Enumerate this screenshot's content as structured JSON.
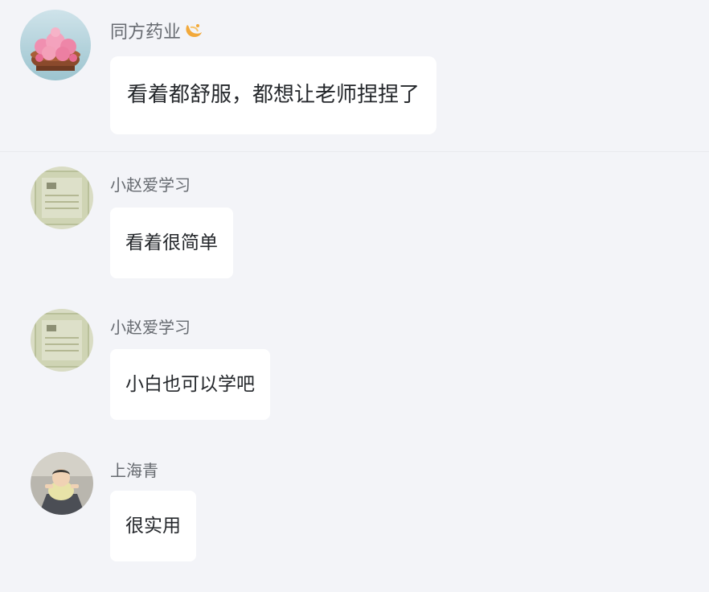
{
  "colors": {
    "background": "#f3f4f8",
    "bubble": "#ffffff",
    "name_text": "#666a70",
    "message_text": "#24272b",
    "badge": "#f2a93b"
  },
  "messages": [
    {
      "user": "同方药业",
      "badge_icon": "crescent-badge-icon",
      "avatar_icon": "flower-basket-avatar",
      "text": "看着都舒服，都想让老师捏捏了"
    },
    {
      "user": "小赵爱学习",
      "avatar_icon": "certificate-avatar",
      "text": "看着很简单"
    },
    {
      "user": "小赵爱学习",
      "avatar_icon": "certificate-avatar",
      "text": "小白也可以学吧"
    },
    {
      "user": "上海青",
      "avatar_icon": "baby-photo-avatar",
      "text": "很实用"
    }
  ]
}
